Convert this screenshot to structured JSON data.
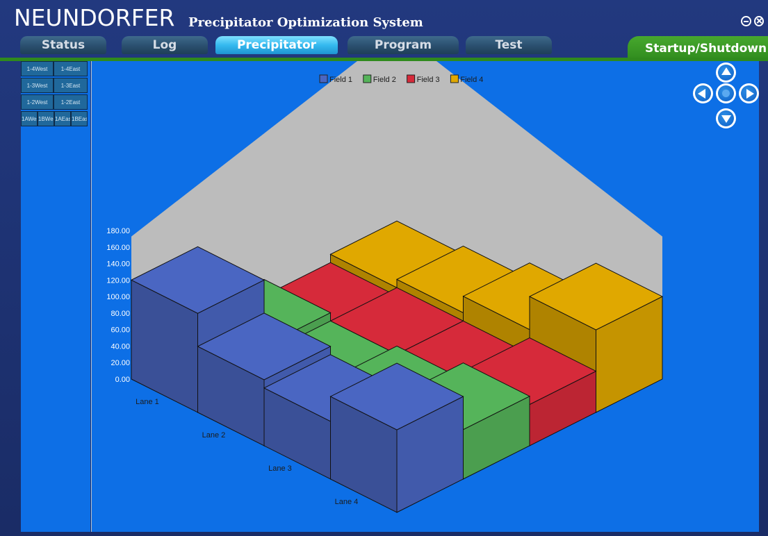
{
  "app": {
    "brand": "NEUNDORFER",
    "subtitle": "Precipitator Optimization System",
    "window_minimize_symbol": "⊖",
    "window_close_symbol": "⊗"
  },
  "tabs": [
    {
      "label": "Status",
      "active": false
    },
    {
      "label": "Log",
      "active": false
    },
    {
      "label": "Precipitator",
      "active": true
    },
    {
      "label": "Program",
      "active": false
    },
    {
      "label": "Test",
      "active": false
    }
  ],
  "startup_tab": "Startup/Shutdown",
  "sections": {
    "row1": [
      "1-4West",
      "1-4East"
    ],
    "row2": [
      "1-3West",
      "1-3East"
    ],
    "row3": [
      "1-2West",
      "1-2East"
    ],
    "row4": [
      "1AWest",
      "1BWest",
      "1AEast",
      "1BEast"
    ]
  },
  "nav_icons": [
    "arrow-up-icon",
    "arrow-left-icon",
    "center-dot-icon",
    "arrow-right-icon",
    "arrow-down-icon"
  ],
  "colors": {
    "field1": "#4a66c2",
    "field2": "#55b45a",
    "field3": "#d62a3a",
    "field4": "#e0a800",
    "panel_bg": "#0d6fe6",
    "back_wall": "#bcbcbc"
  },
  "chart_data": {
    "type": "bar",
    "subtype": "3d-grid",
    "series": [
      {
        "name": "Field 1",
        "values": [
          120,
          80,
          70,
          100
        ]
      },
      {
        "name": "Field 2",
        "values": [
          40,
          30,
          40,
          60
        ]
      },
      {
        "name": "Field 3",
        "values": [
          20,
          30,
          30,
          50
        ]
      },
      {
        "name": "Field 4",
        "values": [
          30,
          40,
          60,
          100
        ]
      }
    ],
    "categories": [
      "Lane 1",
      "Lane 2",
      "Lane 3",
      "Lane 4"
    ],
    "yticks": [
      "0.00",
      "20.00",
      "40.00",
      "60.00",
      "80.00",
      "100.00",
      "120.00",
      "140.00",
      "160.00",
      "180.00"
    ],
    "ylim": [
      0,
      180
    ],
    "legend": "top-center",
    "title": "",
    "xlabel": "",
    "ylabel": ""
  }
}
